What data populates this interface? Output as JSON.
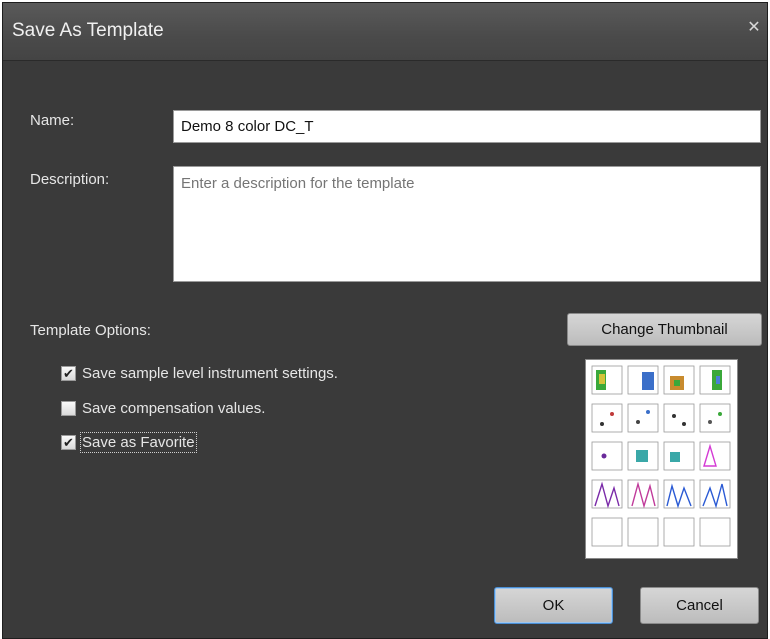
{
  "dialog": {
    "title": "Save As Template",
    "close_glyph": "✕"
  },
  "form": {
    "name_label": "Name:",
    "name_value": "Demo 8 color DC_T",
    "description_label": "Description:",
    "description_placeholder": "Enter a description for the template",
    "options_label": "Template Options:",
    "change_thumbnail_label": "Change Thumbnail"
  },
  "options": [
    {
      "label": "Save sample level instrument settings.",
      "checked": true
    },
    {
      "label": "Save compensation values.",
      "checked": false
    },
    {
      "label": "Save as Favorite",
      "checked": true
    }
  ],
  "buttons": {
    "ok_label": "OK",
    "cancel_label": "Cancel"
  },
  "colors": {
    "dialog_bg": "#3a3a3a",
    "accent_focus": "#4a8fd6"
  },
  "thumbnail": {
    "icon": "template-layout-thumbnail"
  }
}
